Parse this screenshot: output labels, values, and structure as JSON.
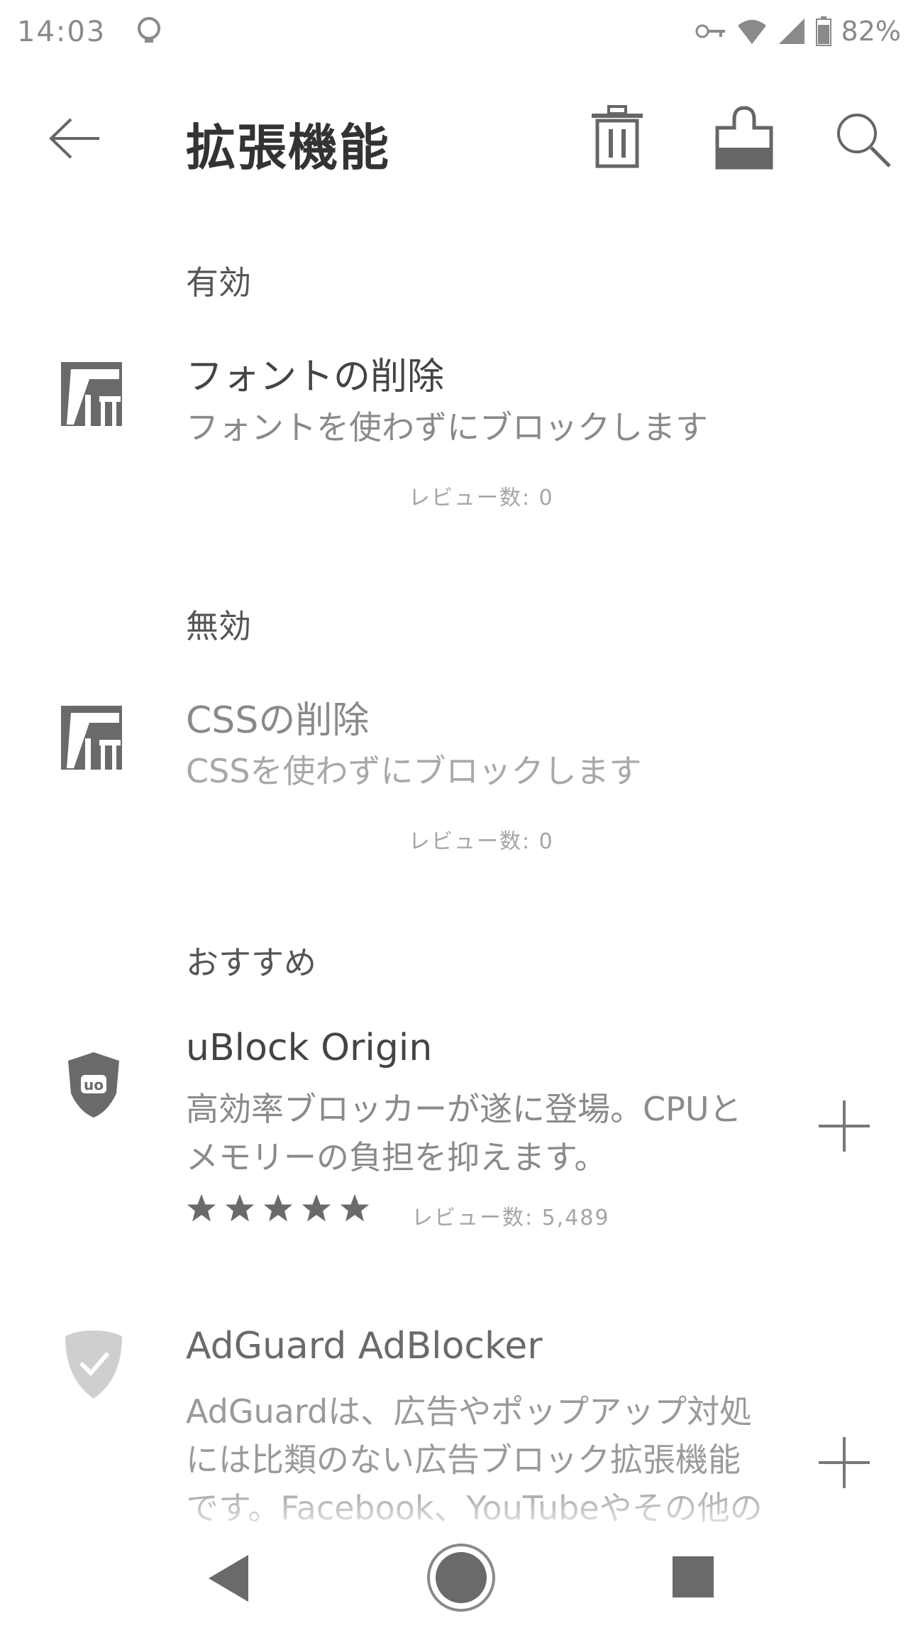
{
  "status_bar": {
    "time": "14:03",
    "battery": "82%"
  },
  "app_bar": {
    "title": "拡張機能"
  },
  "sections": {
    "enabled": "有効",
    "disabled": "無効",
    "recommended": "おすすめ"
  },
  "enabled_items": [
    {
      "title": "フォントの削除",
      "description": "フォントを使わずにブロックします",
      "reviews": "レビュー数: 0",
      "icon": "lines-logo-icon"
    }
  ],
  "disabled_items": [
    {
      "title": "CSSの削除",
      "description": "CSSを使わずにブロックします",
      "reviews": "レビュー数: 0",
      "icon": "lines-logo-icon"
    }
  ],
  "recommended_items": [
    {
      "title": "uBlock Origin",
      "description": "高効率ブロッカーが遂に登場。CPUとメモリーの負担を抑えます。",
      "rating": 5,
      "reviews": "レビュー数: 5,489",
      "icon": "ublock-shield-icon"
    },
    {
      "title": "AdGuard AdBlocker",
      "description": "AdGuardは、広告やポップアップ対処には比類のない広告ブロック拡張機能です。Facebook、YouTubeやその他の全てのサイトで…",
      "icon": "adguard-shield-icon"
    }
  ],
  "colors": {
    "text_primary": "#444444",
    "text_secondary": "#8a8a8a",
    "icon_gray": "#777777"
  }
}
